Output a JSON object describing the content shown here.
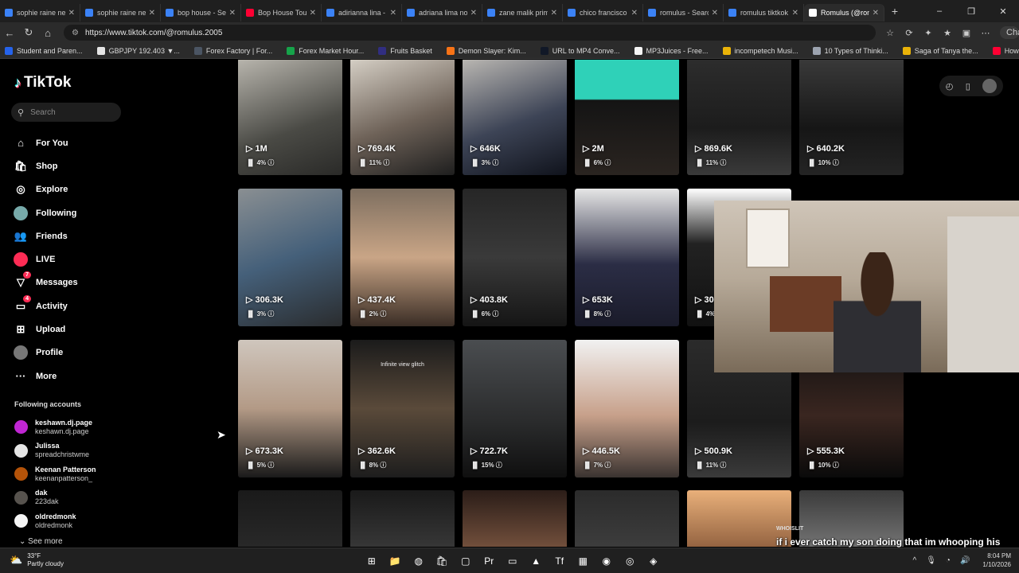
{
  "browser": {
    "tabs": [
      {
        "title": "sophie raine net w",
        "color": "#3b82f6",
        "active": false
      },
      {
        "title": "sophie raine net w",
        "color": "#3b82f6",
        "active": false
      },
      {
        "title": "bop house - Sear",
        "color": "#3b82f6",
        "active": false
      },
      {
        "title": "Bop House Tour 🏽",
        "color": "#ff0033",
        "active": false
      },
      {
        "title": "adirianna lina - Se",
        "color": "#3b82f6",
        "active": false
      },
      {
        "title": "adriana lima nowa",
        "color": "#3b82f6",
        "active": false
      },
      {
        "title": "zane malik prime",
        "color": "#3b82f6",
        "active": false
      },
      {
        "title": "chico francisco - S",
        "color": "#3b82f6",
        "active": false
      },
      {
        "title": "romulus - Search",
        "color": "#3b82f6",
        "active": false
      },
      {
        "title": "romulus tiktkok -",
        "color": "#3b82f6",
        "active": false
      },
      {
        "title": "Romulus (@romu",
        "color": "#ffffff",
        "active": true
      }
    ],
    "new_tab": "+",
    "window_controls": [
      "–",
      "❐",
      "✕"
    ],
    "nav": {
      "back": "←",
      "reload": "↻",
      "home": "⌂"
    },
    "url": "https://www.tiktok.com/@romulus.2005",
    "chat_label": "Chat",
    "bookmarks": [
      {
        "label": "Student and Paren...",
        "color": "#2563eb"
      },
      {
        "label": "GBPJPY 192.403 ▼...",
        "color": "#e5e5e5"
      },
      {
        "label": "Forex Factory | For...",
        "color": "#4b5563"
      },
      {
        "label": "Forex Market Hour...",
        "color": "#16a34a"
      },
      {
        "label": "Fruits Basket",
        "color": "#312e81"
      },
      {
        "label": "Demon Slayer: Kim...",
        "color": "#f97316"
      },
      {
        "label": "URL to MP4 Conve...",
        "color": "#111827"
      },
      {
        "label": "MP3Juices - Free...",
        "color": "#f5f5f5"
      },
      {
        "label": "incompetech Musi...",
        "color": "#eab308"
      },
      {
        "label": "10 Types of Thinki...",
        "color": "#9ca3af"
      },
      {
        "label": "Saga of Tanya the...",
        "color": "#eab308"
      },
      {
        "label": "How to Fix Screen...",
        "color": "#ff0033"
      }
    ]
  },
  "tiktok": {
    "brand": "TikTok",
    "search_placeholder": "Search",
    "nav": [
      {
        "label": "For You",
        "icon": "⌂",
        "name": "home"
      },
      {
        "label": "Shop",
        "icon": "🛍",
        "name": "shop"
      },
      {
        "label": "Explore",
        "icon": "◎",
        "name": "compass"
      },
      {
        "label": "Following",
        "icon": "",
        "name": "following"
      },
      {
        "label": "Friends",
        "icon": "👥",
        "name": "friends"
      },
      {
        "label": "LIVE",
        "icon": "",
        "name": "live"
      },
      {
        "label": "Messages",
        "icon": "▽",
        "name": "messages",
        "badge": "7"
      },
      {
        "label": "Activity",
        "icon": "▭",
        "name": "activity",
        "badge": "4"
      },
      {
        "label": "Upload",
        "icon": "⊞",
        "name": "upload"
      },
      {
        "label": "Profile",
        "icon": "",
        "name": "profile"
      },
      {
        "label": "More",
        "icon": "···",
        "name": "more"
      }
    ],
    "following_title": "Following accounts",
    "accounts": [
      {
        "name": "keshawn.dj.page",
        "handle": "keshawn.dj.page",
        "color": "#c026d3"
      },
      {
        "name": "Julissa",
        "handle": "spreadchristwme",
        "color": "#e5e5e5"
      },
      {
        "name": "Keenan Patterson",
        "handle": "keenanpatterson_",
        "color": "#b45309"
      },
      {
        "name": "dak",
        "handle": "223dak",
        "color": "#57534e"
      },
      {
        "name": "oldredmonk",
        "handle": "oldredmonk",
        "color": "#f5f5f5"
      }
    ],
    "see_more": "See more",
    "top_icons": [
      "◴",
      "▯"
    ]
  },
  "videos": [
    {
      "views": "1M",
      "pct": "4%",
      "bg": "linear-gradient(160deg,#b9b6ae,#4a4a45 60%,#2a2a28)"
    },
    {
      "views": "769.4K",
      "pct": "11%",
      "bg": "linear-gradient(160deg,#d6d0c6,#6e6258 55%,#1e1e1e)"
    },
    {
      "views": "646K",
      "pct": "3%",
      "bg": "linear-gradient(160deg,#bbb8b3,#3d4456 55%,#10131c)"
    },
    {
      "views": "2M",
      "pct": "6%",
      "bg": "linear-gradient(180deg,#2fd1b8 0 35%,#141414 36%,#2a2420)"
    },
    {
      "views": "869.6K",
      "pct": "11%",
      "bg": "linear-gradient(180deg,#2d2d2d,#1c1c1c 60%,#3a3a3a)"
    },
    {
      "views": "640.2K",
      "pct": "10%",
      "bg": "linear-gradient(180deg,#3a3a3a,#161616 60%,#242424)"
    },
    {
      "views": "306.3K",
      "pct": "3%",
      "bg": "linear-gradient(160deg,#8a8f92,#45607a 50%,#2a2c2e)"
    },
    {
      "views": "437.4K",
      "pct": "2%",
      "bg": "linear-gradient(180deg,#7e6f60,#c9a586 50%,#3a2d25)"
    },
    {
      "views": "403.8K",
      "pct": "6%",
      "bg": "linear-gradient(180deg,#262626,#3a3a3a 50%,#151515)"
    },
    {
      "views": "653K",
      "pct": "8%",
      "bg": "linear-gradient(180deg,#e6e6e6,#2b2d45 55%,#1a1b2a)"
    },
    {
      "views": "306.1K",
      "pct": "4%",
      "bg": "linear-gradient(180deg,#ffffff,#222 40%,#111)"
    },
    {
      "views": "",
      "pct": "",
      "bg": "#000"
    },
    {
      "views": "673.3K",
      "pct": "5%",
      "bg": "linear-gradient(180deg,#cfc6bd,#b39a86 50%,#1a1a1a)"
    },
    {
      "views": "362.6K",
      "pct": "8%",
      "bg": "linear-gradient(180deg,#1b1b1b,#5a4a3a 50%,#1d1d1d)",
      "caption": "Infinite view glitch"
    },
    {
      "views": "722.7K",
      "pct": "15%",
      "bg": "linear-gradient(180deg,#4a4d50,#2a2b2c 60%,#0f0f0f)"
    },
    {
      "views": "446.5K",
      "pct": "7%",
      "bg": "linear-gradient(180deg,#f1f1f1,#c7a08a 55%,#3a3330)"
    },
    {
      "views": "500.9K",
      "pct": "11%",
      "bg": "linear-gradient(180deg,#2b2b2b,#1c1c1c 60%,#3a3a3a)"
    },
    {
      "views": "555.3K",
      "pct": "10%",
      "bg": "linear-gradient(180deg,#101010,#3a2620 55%,#0a0a0a)"
    },
    {
      "views": "",
      "pct": "",
      "bg": "linear-gradient(180deg,#1a1a1a,#2a2a2a)"
    },
    {
      "views": "",
      "pct": "",
      "bg": "linear-gradient(180deg,#1a1a1a,#3a3a3a)"
    },
    {
      "views": "",
      "pct": "",
      "bg": "linear-gradient(180deg,#2b1d18,#7a5540)"
    },
    {
      "views": "",
      "pct": "",
      "bg": "linear-gradient(180deg,#2b2b2b,#3f3f3f)"
    },
    {
      "views": "",
      "pct": "",
      "bg": "linear-gradient(180deg,#e9b07a,#8a5a3a)"
    },
    {
      "views": "",
      "pct": "",
      "bg": "linear-gradient(180deg,#3b3b3b,#7a7a7a)"
    }
  ],
  "overlay": {
    "whoislit": "WHOISLIT",
    "subtitle": "if i ever catch my son doing that im whooping his ahh"
  },
  "taskbar": {
    "temp": "33°F",
    "condition": "Partly cloudy",
    "apps": [
      "⊞",
      "📁",
      "◍",
      "🛍",
      "▢",
      "Pr",
      "▭",
      "▲",
      "Tf",
      "▦",
      "◉",
      "◎",
      "◈"
    ],
    "tray": [
      "^",
      "🎙",
      "◔",
      "🔊"
    ],
    "time": "8:04 PM",
    "date": "1/10/2026"
  }
}
